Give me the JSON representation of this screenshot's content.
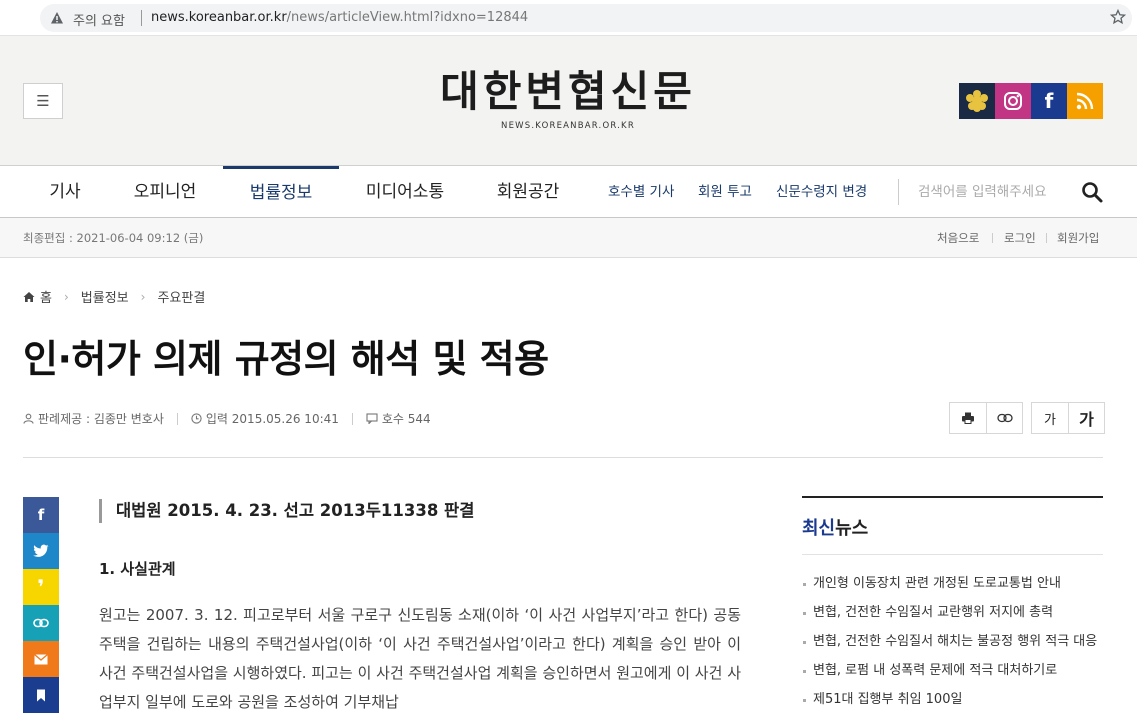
{
  "browser": {
    "warning": "주의 요함",
    "url_host": "news.koreanbar.or.kr",
    "url_path": "/news/articleView.html?idxno=12844"
  },
  "header": {
    "logo": "대한변협신문",
    "logo_sub": "NEWS.KOREANBAR.OR.KR",
    "social": [
      "koreanbar-icon",
      "instagram-icon",
      "facebook-icon",
      "rss-icon"
    ]
  },
  "nav": {
    "items": [
      {
        "label": "기사"
      },
      {
        "label": "오피니언"
      },
      {
        "label": "법률정보"
      },
      {
        "label": "미디어소통"
      },
      {
        "label": "회원공간"
      }
    ],
    "sub_items": [
      {
        "label": "호수별 기사"
      },
      {
        "label": "회원 투고"
      },
      {
        "label": "신문수령지 변경"
      }
    ],
    "search_placeholder": "검색어를 입력해주세요"
  },
  "infobar": {
    "updated": "최종편집 : 2021-06-04 09:12 (금)",
    "links": [
      "처음으로",
      "로그인",
      "회원가입"
    ]
  },
  "breadcrumb": [
    "홈",
    "법률정보",
    "주요판결"
  ],
  "article": {
    "title": "인·허가 의제 규정의 해석 및 적용",
    "author": "판례제공 : 김종만 변호사",
    "published": "입력 2015.05.26 10:41",
    "issue": "호수 544",
    "font_small": "가",
    "font_large": "가",
    "subtitle": "대법원 2015. 4. 23. 선고 2013두11338 판결",
    "section": "1. 사실관계",
    "body": "원고는 2007. 3. 12. 피고로부터 서울 구로구 신도림동 소재(이하 ‘이 사건 사업부지’라고 한다) 공동주택을 건립하는 내용의 주택건설사업(이하 ‘이 사건 주택건설사업’이라고 한다) 계획을 승인 받아 이 사건 주택건설사업을 시행하였다. 피고는 이 사건 주택건설사업 계획을 승인하면서 원고에게 이 사건 사업부지 일부에 도로와 공원을 조성하여 기부채납"
  },
  "share": [
    {
      "icon": "facebook-icon",
      "color": "#3b5998"
    },
    {
      "icon": "twitter-icon",
      "color": "#1d87c9"
    },
    {
      "icon": "kakaostory-icon",
      "color": "#f7d600"
    },
    {
      "icon": "link-icon",
      "color": "#16a1b7"
    },
    {
      "icon": "email-icon",
      "color": "#f07a1a"
    },
    {
      "icon": "bookmark-icon",
      "color": "#1a3d8f"
    }
  ],
  "sidebar": {
    "title_accent": "최신",
    "title_rest": "뉴스",
    "items": [
      "개인형 이동장치 관련 개정된 도로교통법 안내",
      "변협, 건전한 수임질서 교란행위 저지에 총력",
      "변협, 건전한 수임질서 해치는 불공정 행위 적극 대응",
      "변협, 로펌 내 성폭력 문제에 적극 대처하기로",
      "제51대 집행부 취임 100일"
    ]
  }
}
